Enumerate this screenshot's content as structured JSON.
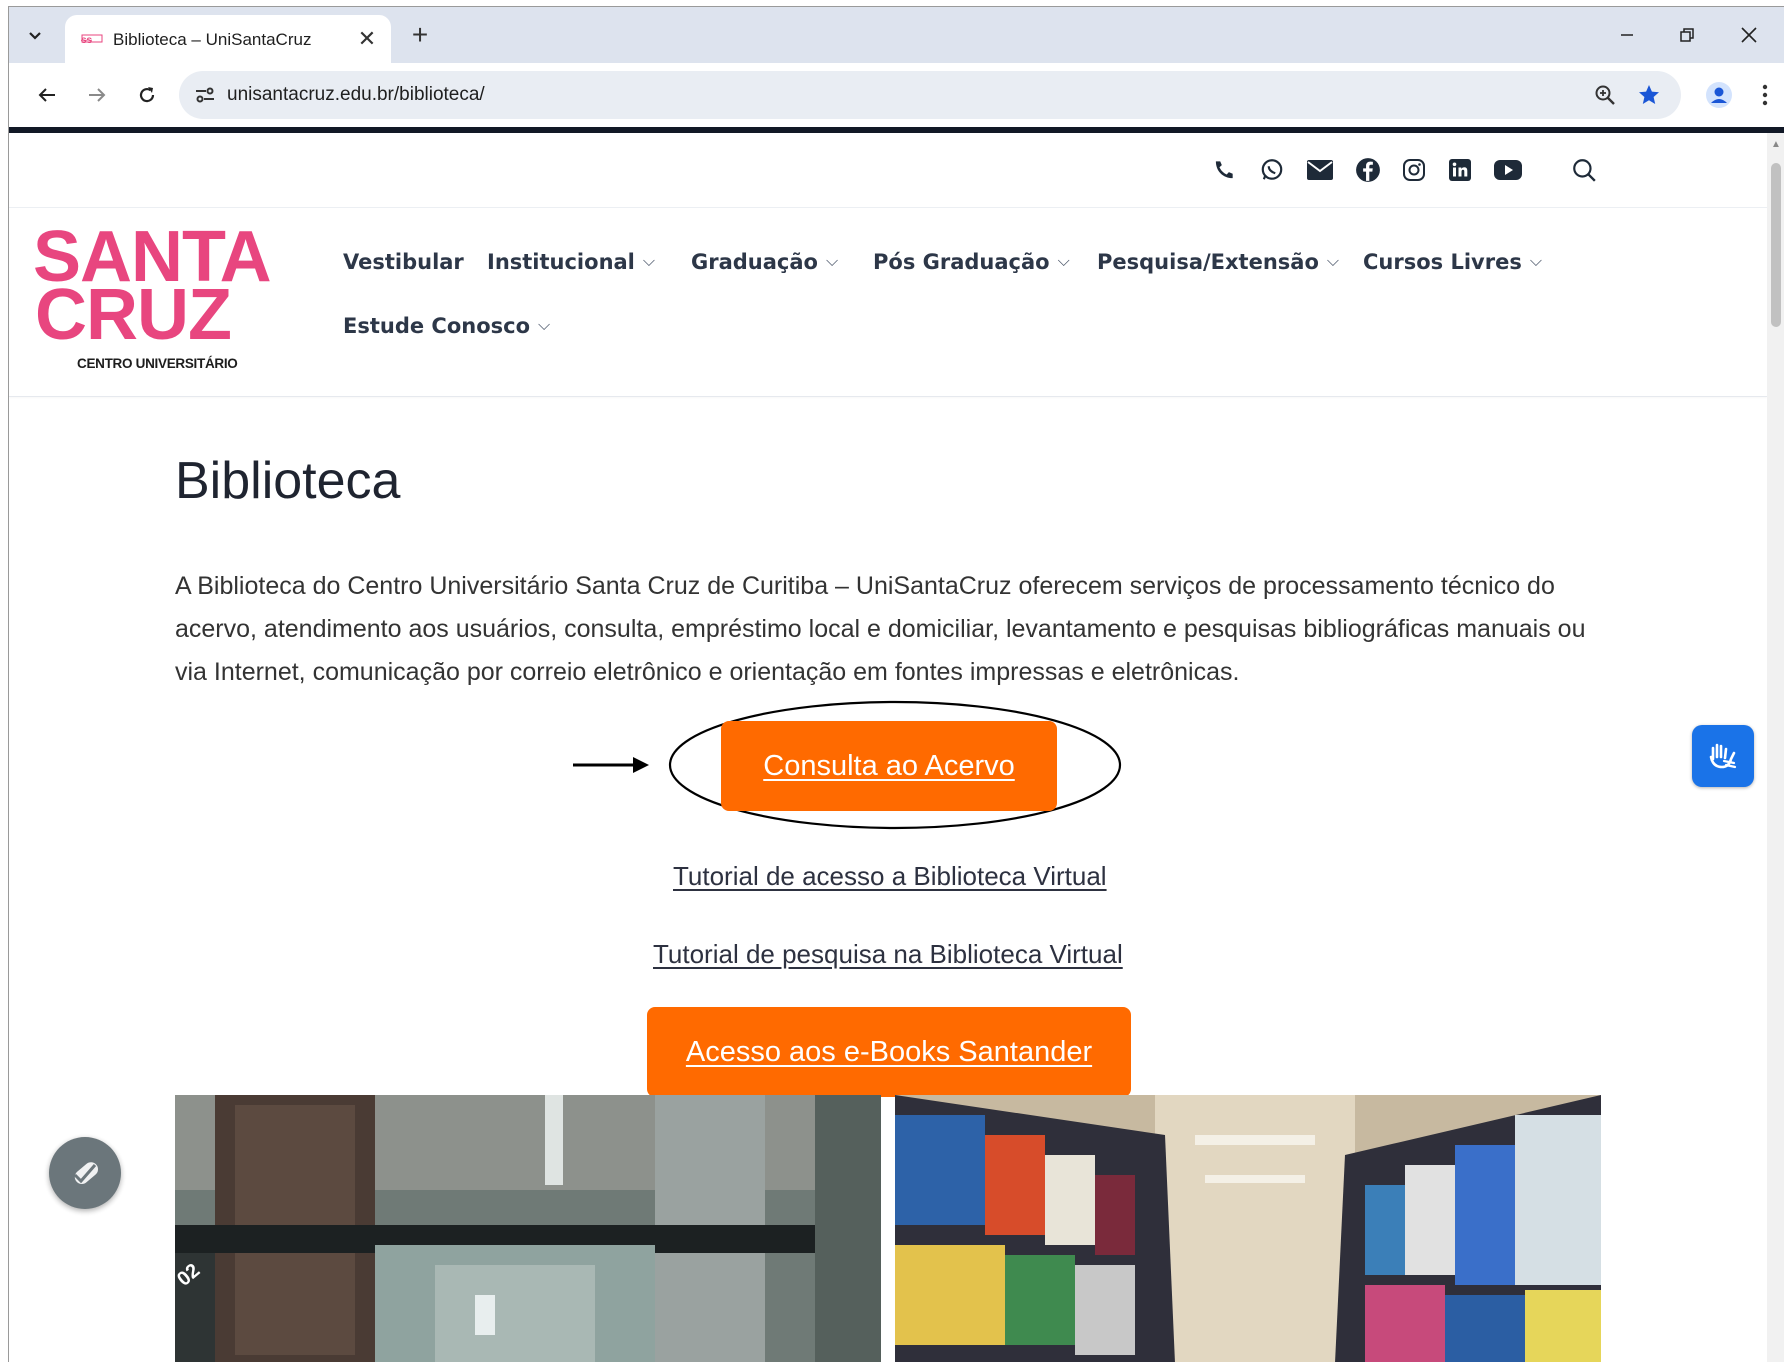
{
  "browser": {
    "tab_title": "Biblioteca – UniSantaCruz",
    "tab_close": "✕",
    "new_tab": "+",
    "url": "unisantacruz.edu.br/biblioteca/"
  },
  "site": {
    "logo": {
      "line1": "SANTA",
      "line2": "CRUZ",
      "subtitle": "CENTRO UNIVERSITÁRIO",
      "color": "#e8467f"
    },
    "social_icons": [
      "phone-icon",
      "whatsapp-icon",
      "email-icon",
      "facebook-icon",
      "instagram-icon",
      "linkedin-icon",
      "youtube-icon",
      "search-icon"
    ],
    "menu": [
      {
        "label": "Vestibular"
      },
      {
        "label": "Institucional"
      },
      {
        "label": "Graduação"
      },
      {
        "label": "Pós Graduação"
      },
      {
        "label": "Pesquisa/Extensão"
      },
      {
        "label": "Cursos Livres"
      },
      {
        "label": "Estude Conosco"
      }
    ]
  },
  "page": {
    "title": "Biblioteca",
    "intro": "A Biblioteca do Centro Universitário Santa Cruz de Curitiba – UniSantaCruz oferecem serviços de processamento técnico do acervo, atendimento aos usuários, consulta, empréstimo local e domiciliar, levantamento e pesquisas bibliográficas manuais ou via Internet, comunicação por correio eletrônico e orientação em fontes impressas e eletrônicas.",
    "primary_button": "Consulta ao Acervo",
    "link1": "Tutorial de acesso a Biblioteca Virtual",
    "link2": "Tutorial de pesquisa na Biblioteca Virtual",
    "secondary_button": "Acesso aos e-Books Santander",
    "accent_color": "#ff6a00"
  }
}
